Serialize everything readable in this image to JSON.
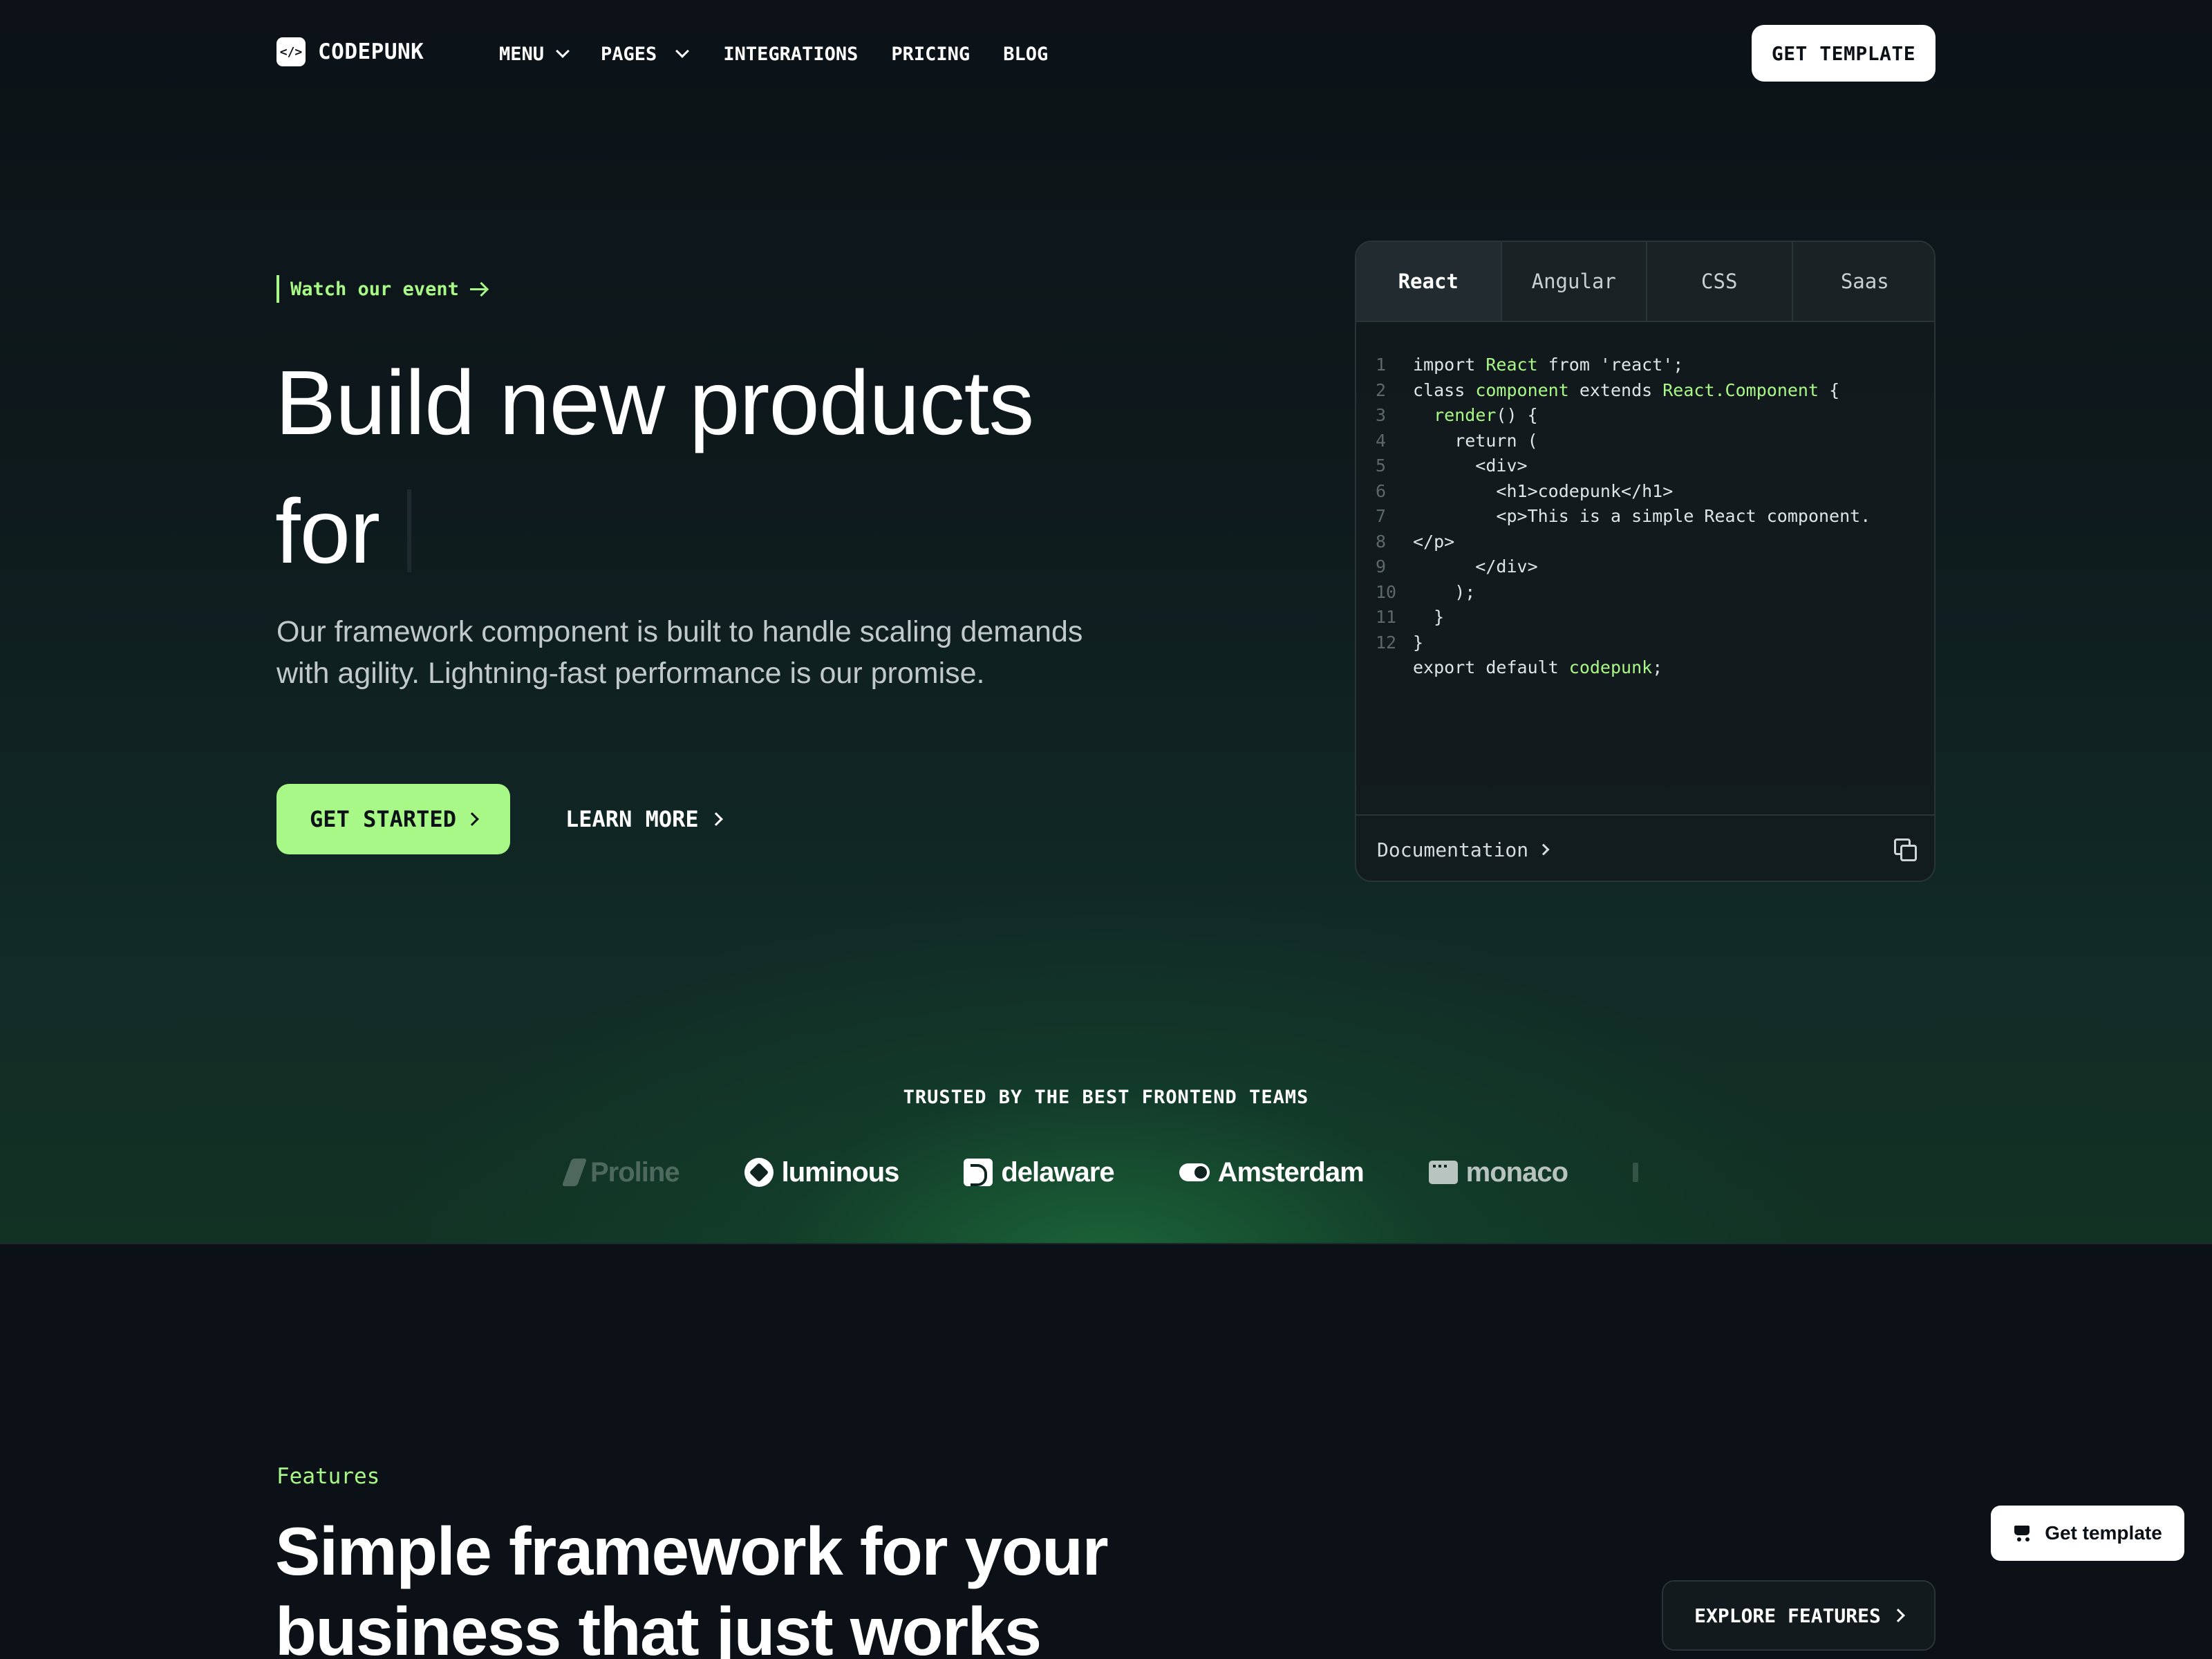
{
  "brand": {
    "name": "CODEPUNK",
    "mark": "</>"
  },
  "nav": {
    "items": [
      {
        "label": "MENU",
        "has_dropdown": true
      },
      {
        "label": "PAGES",
        "has_dropdown": true
      },
      {
        "label": "INTEGRATIONS",
        "has_dropdown": false
      },
      {
        "label": "PRICING",
        "has_dropdown": false
      },
      {
        "label": "BLOG",
        "has_dropdown": false
      }
    ],
    "cta": "GET TEMPLATE"
  },
  "hero": {
    "event_link": "Watch our event",
    "title_line1": "Build new products",
    "title_line2": "for",
    "subtitle": "Our framework component is built to handle scaling demands with agility. Lightning-fast performance is our promise.",
    "primary_cta": "GET STARTED",
    "secondary_cta": "LEARN MORE"
  },
  "code_card": {
    "tabs": [
      "React",
      "Angular",
      "CSS",
      "Saas"
    ],
    "active_tab": "React",
    "line_numbers": [
      "1",
      "2",
      "3",
      "4",
      "5",
      "6",
      "7",
      "8",
      "9",
      "10",
      "11",
      "12"
    ],
    "lines": [
      "import React from 'react';",
      "class component extends React.Component {",
      "  render() {",
      "    return (",
      "      <div>",
      "        <h1>codepunk</h1>",
      "        <p>This is a simple React component.",
      "</p>",
      "      </div>",
      "    );",
      "  }",
      "}",
      "export default codepunk;"
    ],
    "footer_link": "Documentation"
  },
  "trusted": {
    "title": "TRUSTED BY THE BEST FRONTEND TEAMS",
    "logos": [
      "Proline",
      "luminous",
      "delaware",
      "Amsterdam",
      "monaco"
    ]
  },
  "features": {
    "label": "Features",
    "title_line1": "Simple framework for your",
    "title_line2": "business that just works",
    "cta": "EXPLORE FEATURES"
  },
  "floating": {
    "label": "Get template"
  },
  "colors": {
    "accent": "#a8f888",
    "background": "#0b1116",
    "card_border": "#2a3538"
  }
}
